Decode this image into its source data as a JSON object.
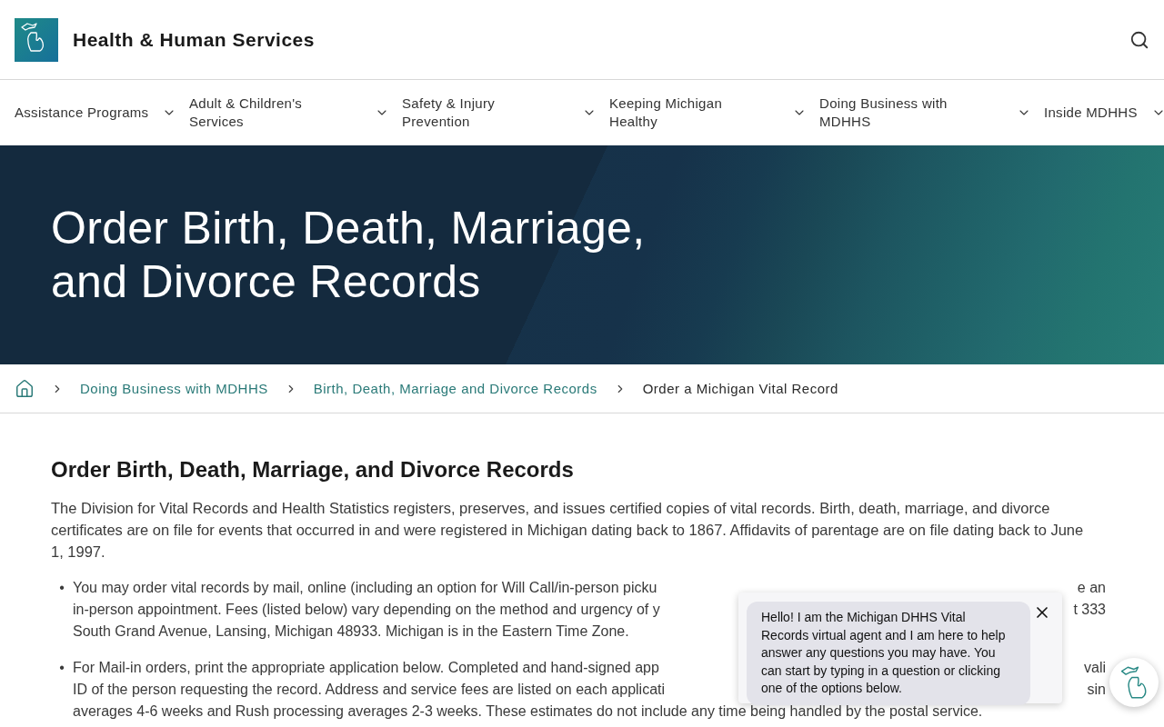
{
  "header": {
    "site_title": "Health & Human Services"
  },
  "nav": [
    {
      "label": "Assistance Programs"
    },
    {
      "label": "Adult & Children's Services"
    },
    {
      "label": "Safety & Injury Prevention"
    },
    {
      "label": "Keeping Michigan Healthy"
    },
    {
      "label": "Doing Business with MDHHS"
    },
    {
      "label": "Inside MDHHS"
    }
  ],
  "hero": {
    "title": "Order Birth, Death, Marriage, and Divorce Records"
  },
  "breadcrumbs": [
    {
      "label": "Doing Business with MDHHS",
      "kind": "link"
    },
    {
      "label": "Birth, Death, Marriage and Divorce Records",
      "kind": "link"
    },
    {
      "label": "Order a Michigan Vital Record",
      "kind": "current"
    }
  ],
  "content": {
    "heading": "Order Birth, Death, Marriage, and Divorce Records",
    "intro": "The Division for Vital Records and Health Statistics registers, preserves, and issues certified copies of vital records. Birth, death, marriage, and divorce certificates are on file for events that occurred in and were registered in Michigan dating back to 1867. Affidavits of parentage are on file dating back to June 1, 1997.",
    "bullets": [
      {
        "marker": "•",
        "lines": [
          {
            "left": "You may order vital records by mail, online (including an option for Will Call/in-person picku",
            "right": "e an"
          },
          {
            "left": "in-person appointment. Fees (listed below) vary depending on the method and urgency of y",
            "right": "t 333"
          },
          {
            "left": "South Grand Avenue, Lansing, Michigan 48933. Michigan is in the Eastern Time Zone."
          }
        ]
      },
      {
        "marker": "•",
        "lines": [
          {
            "left": "For Mail-in orders, print the appropriate application below. Completed and hand-signed app",
            "right": "vali"
          },
          {
            "left": "ID of the person requesting the record. Address and service fees are listed on each applicati",
            "right": "sin"
          },
          {
            "left": "averages 4-6 weeks and Rush processing averages 2-3 weeks. These estimates do not include any time being handled by the postal service."
          }
        ]
      }
    ]
  },
  "chat": {
    "message": "Hello! I am the Michigan DHHS Vital Records virtual agent and I am here to help answer any questions you may have. You can start by typing in a question or clicking one of the options below."
  }
}
